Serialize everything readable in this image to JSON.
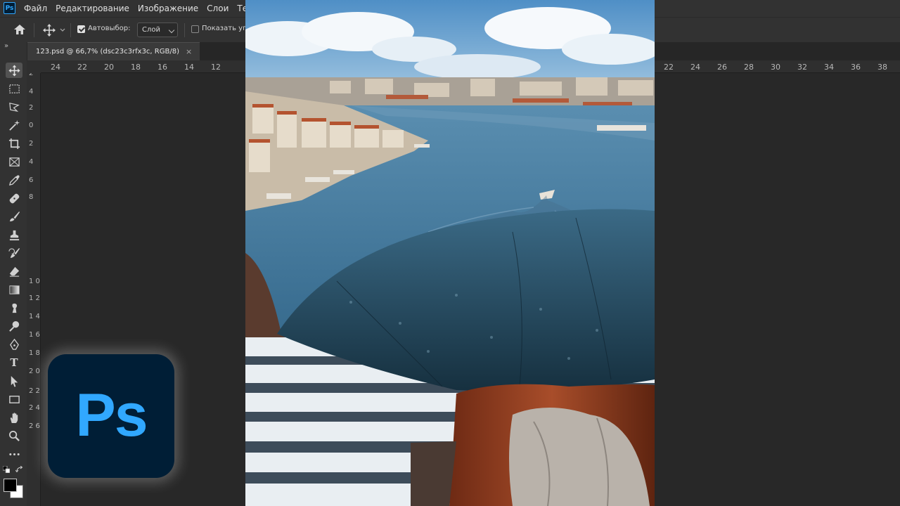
{
  "app": {
    "logo_text": "Ps"
  },
  "menu": [
    "Файл",
    "Редактирование",
    "Изображение",
    "Слои",
    "Текст"
  ],
  "options": {
    "auto_select_label": "Автовыбор:",
    "auto_select_checked": true,
    "layer_select": "Слой",
    "show_controls_label": "Показать упр",
    "show_controls_checked": false
  },
  "tab": {
    "title": "123.psd @ 66,7% (dsc23c3rfx3c, RGB/8)",
    "close": "×"
  },
  "toolbar": {
    "collapse": "»",
    "type_tool": "T"
  },
  "ruler_h": [
    "24",
    "22",
    "20",
    "18",
    "16",
    "14",
    "12",
    "22",
    "24",
    "26",
    "28",
    "30",
    "32",
    "34",
    "36",
    "38"
  ],
  "ruler_v": [
    "2",
    "4",
    "2",
    "0",
    "2",
    "4",
    "6",
    "8",
    "1 0",
    "1 2",
    "1 4",
    "1 6",
    "1 8",
    "2 0",
    "2 2",
    "2 4",
    "2 6"
  ],
  "overlay_logo": "Ps",
  "colors": {
    "accent": "#31a8ff",
    "logo_bg": "#001e36"
  }
}
